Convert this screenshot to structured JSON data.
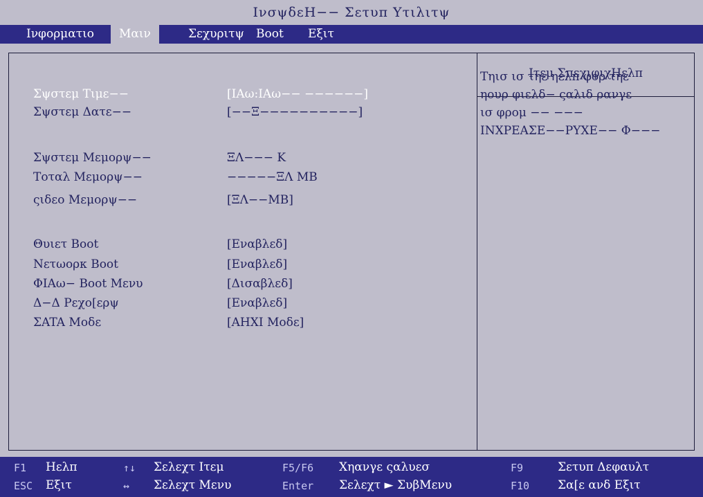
{
  "title": "ΙνσψδεΗ−− Σετυπ Υτιλιτψ",
  "menu": {
    "items": [
      "Ινφορματιο",
      "Μαιν",
      "Σεχυριτψ",
      "Boot",
      "Εξιτ"
    ]
  },
  "settings": [
    {
      "label": "Σψστεμ Τιμε−−",
      "value": "[ΙΑω:ΙΑω−− −−−−−−]"
    },
    {
      "label": "Σψστεμ Δατε−−",
      "value": "[−−Ξ−−−−−−−−−−]"
    },
    {
      "label": "Σψστεμ Μεμορψ−−",
      "value": "ΞΛ−−− K"
    },
    {
      "label": "Τοταλ Μεμορψ−−",
      "value": "−−−−−ΞΛ MB"
    },
    {
      "label": "ςιδεο Μεμορψ−−",
      "value": "[ΞΛ−−MB]"
    },
    {
      "label": "Θυιετ Boot",
      "value": "[Εναβλεδ]"
    },
    {
      "label": "Νετωορκ Boot",
      "value": "[Εναβλεδ]"
    },
    {
      "label": "ΦΙΑω− Boot Μενυ",
      "value": "[Δισαβλεδ]"
    },
    {
      "label": "Δ−Δ Ρεχο[ερψ",
      "value": "[Εναβλεδ]"
    },
    {
      "label": "ΣATA Μοδε",
      "value": "[AHXI Μοδε]"
    }
  ],
  "help": {
    "title": "Ιτεμ ΣπεχιφιχΗελπ",
    "lines": [
      "Τηισ ισ τηε ηελπ φορ τηε",
      "ηουρ φιελδ− ςαλιδ ρανγε",
      "ισ φρομ −− −−−",
      "INXPEAΣΕ−−ΡΥΧΕ−− Φ−−−"
    ]
  },
  "statusbar": {
    "row1": [
      {
        "key": "F1",
        "desc": "Ηελπ"
      },
      {
        "key": "↑↓",
        "desc": "Σελεχτ Ιτεμ"
      },
      {
        "key": "F5/F6",
        "desc": "Χηανγε ςαλυεσ"
      },
      {
        "key": "F9",
        "desc": "Σετυπ Δεφαυλτ"
      }
    ],
    "row2": [
      {
        "key": "ESC",
        "desc": "Εξιτ"
      },
      {
        "key": "↔",
        "desc": "Σελεχτ Μενυ"
      },
      {
        "key": "Enter",
        "desc": "Σελεχτ ► ΣυβΜενυ"
      },
      {
        "key": "F10",
        "desc": "Σα[ε ανδ Εξιτ"
      }
    ]
  }
}
